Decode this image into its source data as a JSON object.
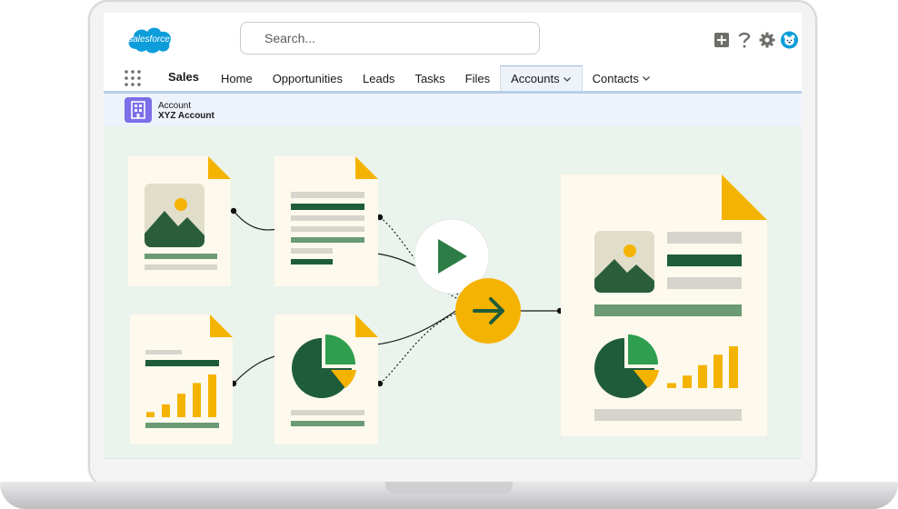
{
  "app": {
    "logo_text": "salesforce",
    "app_name": "Sales"
  },
  "search": {
    "placeholder": "Search..."
  },
  "utility_icons": [
    "add-icon",
    "help-icon",
    "gear-icon",
    "bear-avatar-icon"
  ],
  "nav": {
    "items": [
      {
        "label": "Home",
        "dropdown": false,
        "active": false
      },
      {
        "label": "Opportunities",
        "dropdown": false,
        "active": false
      },
      {
        "label": "Leads",
        "dropdown": false,
        "active": false
      },
      {
        "label": "Tasks",
        "dropdown": false,
        "active": false
      },
      {
        "label": "Files",
        "dropdown": false,
        "active": false
      },
      {
        "label": "Accounts",
        "dropdown": true,
        "active": true
      },
      {
        "label": "Contacts",
        "dropdown": true,
        "active": false
      }
    ]
  },
  "record": {
    "type_label": "Account",
    "name": "XYZ Account",
    "icon": "building-icon"
  },
  "colors": {
    "brand_blue": "#0d9dda",
    "dark_green": "#1f5c3a",
    "mid_green": "#2e7d46",
    "light_green": "#6b9a74",
    "accent_yellow": "#f5b301",
    "canvas_bg": "#eaf3ec",
    "doc_bg": "#fdf9ec",
    "record_icon": "#7c6ee8"
  },
  "illustration": {
    "icons": [
      "image-document-icon",
      "text-document-icon",
      "chart-document-icon",
      "pie-chart-document-icon",
      "play-icon",
      "arrow-right-icon",
      "report-document-icon"
    ],
    "bar_chart_levels": [
      0.12,
      0.3,
      0.55,
      0.8,
      1.0
    ],
    "report_bar_chart_levels": [
      0.12,
      0.3,
      0.55,
      0.8,
      1.0
    ]
  }
}
